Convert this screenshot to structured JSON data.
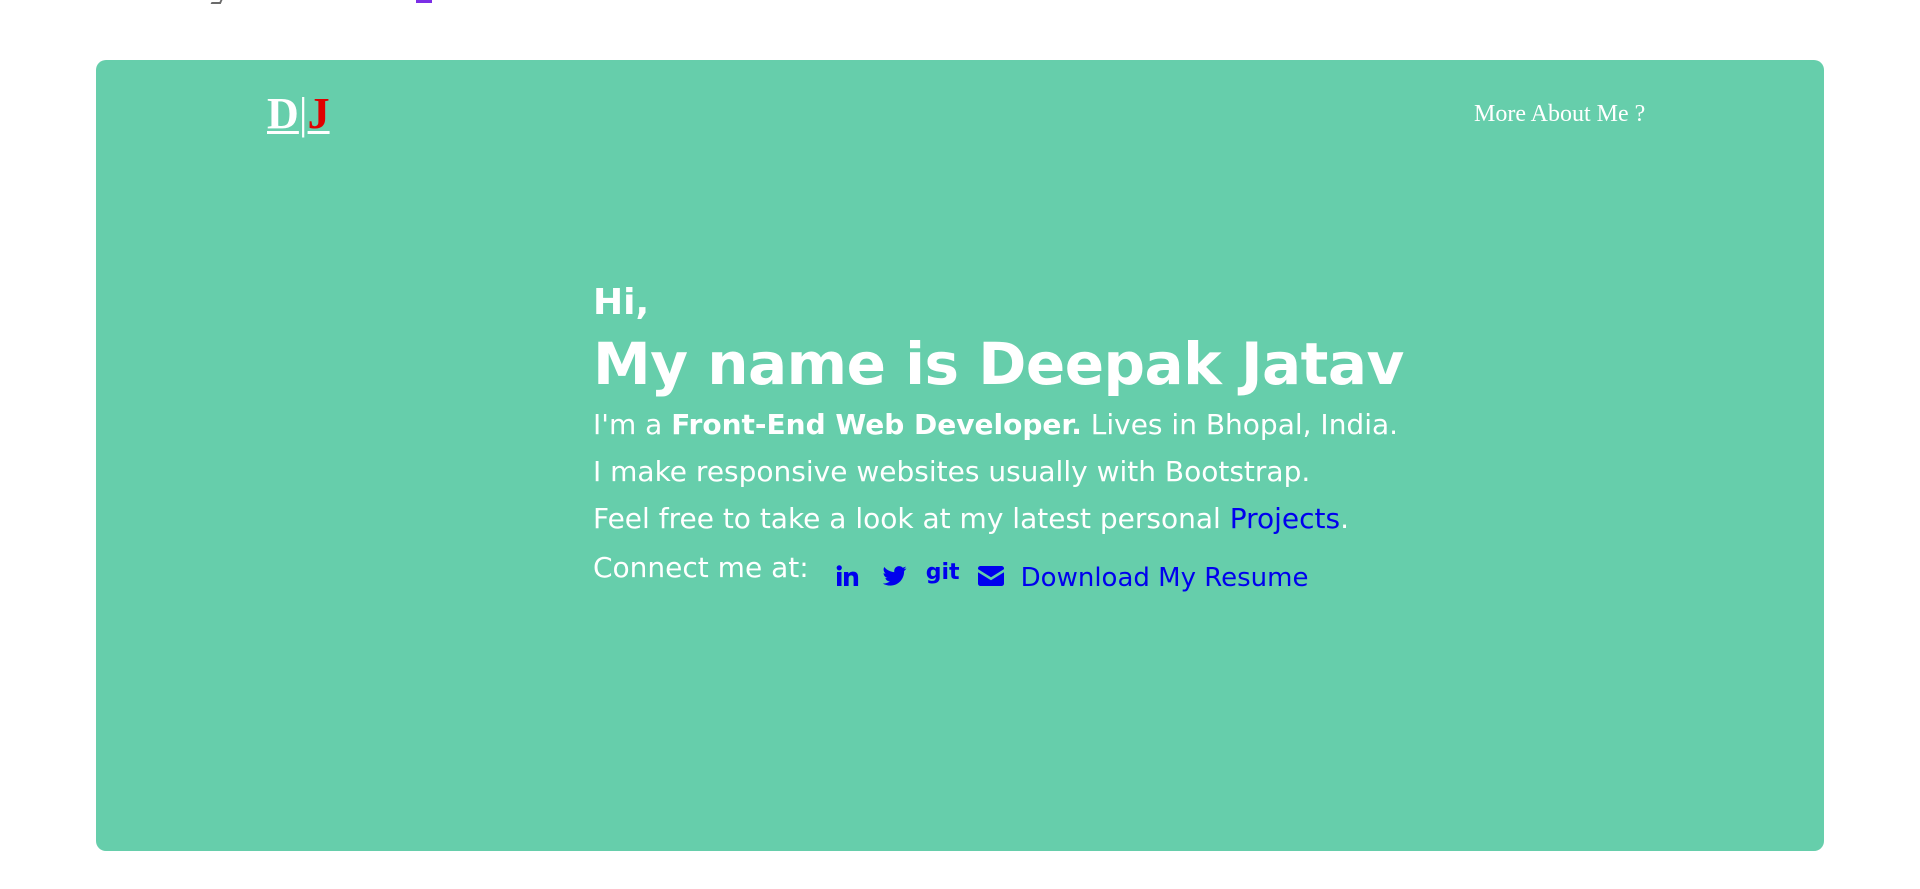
{
  "brand": {
    "first": "D",
    "separator": "|",
    "second": "J"
  },
  "nav": {
    "more_about": "More About Me ?"
  },
  "hero": {
    "greeting": "Hi,",
    "headline": "My name is Deepak Jatav",
    "intro_prefix": "I'm a ",
    "role": "Front-End Web Developer.",
    "intro_suffix": " Lives in Bhopal, India.",
    "line2": "I make responsive websites usually with Bootstrap.",
    "line3_prefix": "Feel free to take a look at my latest personal ",
    "projects_link": "Projects",
    "line3_suffix": ".",
    "connect_label": "Connect me at:",
    "social": {
      "linkedin_icon": "linkedin-icon",
      "twitter_icon": "twitter-icon",
      "git_text": "git",
      "email_icon": "envelope-icon"
    },
    "resume_link": "Download My Resume"
  },
  "colors": {
    "background": "#66ceab",
    "text": "#ffffff",
    "link": "#0000ee",
    "brand_accent": "#e00000"
  }
}
